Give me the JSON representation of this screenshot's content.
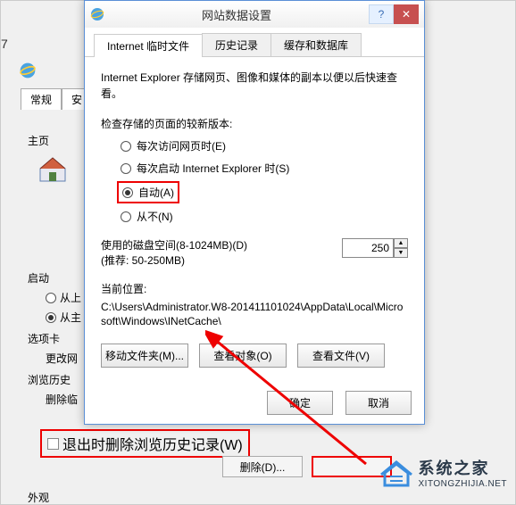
{
  "bg": {
    "num": "7",
    "tab_general": "常规",
    "tab_sec": "安",
    "home": "主页",
    "startup": "启动",
    "radio_last": "从上",
    "radio_home": "从主",
    "tabcard": "选项卡",
    "change": "更改网",
    "history": "浏览历史",
    "delete": "删除临",
    "exit_delete": "退出时删除浏览历史记录(W)",
    "delete_btn": "删除(D)...",
    "appearance": "外观"
  },
  "dialog": {
    "title": "网站数据设置",
    "help": "?",
    "close": "✕",
    "tabs": {
      "temp": "Internet 临时文件",
      "history": "历史记录",
      "cache": "缓存和数据库"
    },
    "desc": "Internet Explorer 存储网页、图像和媒体的副本以便以后快速查看。",
    "check_label": "检查存储的页面的较新版本:",
    "radios": {
      "visit": "每次访问网页时(E)",
      "start": "每次启动 Internet Explorer 时(S)",
      "auto": "自动(A)",
      "never": "从不(N)"
    },
    "disk": {
      "label": "使用的磁盘空间(8-1024MB)(D)",
      "hint": "(推荐: 50-250MB)",
      "value": "250"
    },
    "location": {
      "label": "当前位置:",
      "path": "C:\\Users\\Administrator.W8-201411101024\\AppData\\Local\\Microsoft\\Windows\\INetCache\\"
    },
    "buttons": {
      "move": "移动文件夹(M)...",
      "view_obj": "查看对象(O)",
      "view_file": "查看文件(V)",
      "ok": "确定",
      "cancel": "取消"
    }
  },
  "watermark": {
    "cn": "系统之家",
    "en": "XITONGZHIJIA.NET"
  }
}
